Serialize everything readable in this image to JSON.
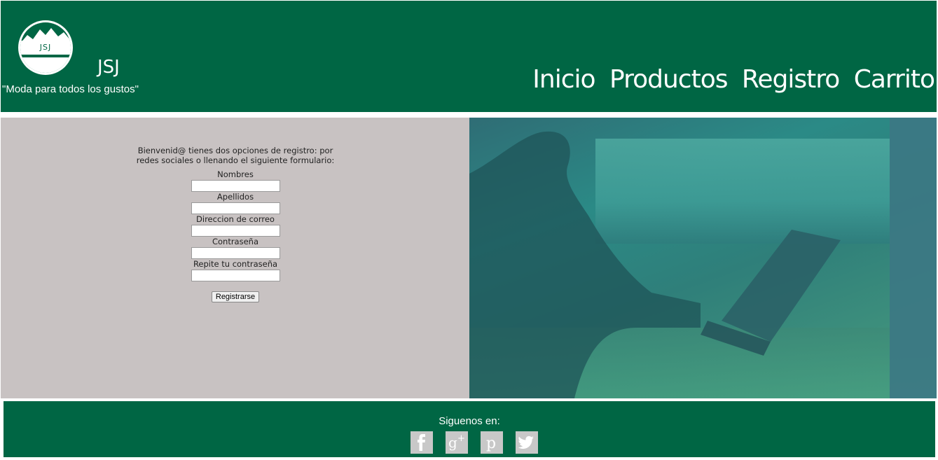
{
  "header": {
    "logo_text": "JSJ",
    "brand": "JSJ",
    "tagline": "\"Moda para todos los gustos\"",
    "nav": [
      "Inicio",
      "Productos",
      "Registro",
      "Carrito"
    ]
  },
  "form": {
    "intro": "Bienvenid@ tienes dos opciones de registro: por redes sociales o llenando el siguiente formulario:",
    "fields": [
      {
        "label": "Nombres",
        "value": ""
      },
      {
        "label": "Apellidos",
        "value": ""
      },
      {
        "label": "Direccion de correo",
        "value": ""
      },
      {
        "label": "Contraseña",
        "value": ""
      },
      {
        "label": "Repite tu contraseña",
        "value": ""
      }
    ],
    "submit_label": "Registrarse"
  },
  "hero": {
    "image": "person-with-laptop"
  },
  "footer": {
    "follow_text": "Siguenos en:",
    "social": [
      "facebook-icon",
      "google-plus-icon",
      "pinterest-icon",
      "twitter-icon"
    ]
  },
  "colors": {
    "brand_green": "#006644",
    "panel_gray": "#c8c2c2",
    "icon_gray": "#c8c8c8"
  }
}
